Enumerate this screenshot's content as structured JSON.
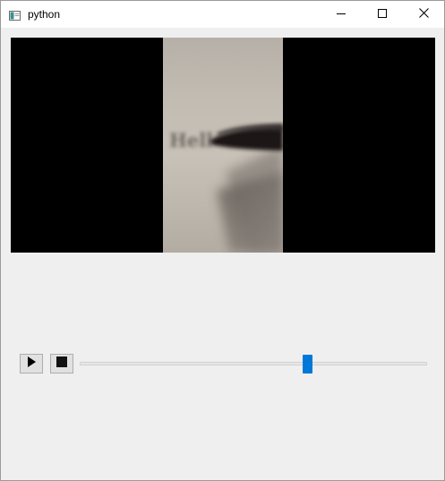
{
  "window": {
    "title": "python",
    "app_icon": "python-window-icon"
  },
  "title_controls": {
    "minimize_icon": "minimize-icon",
    "maximize_icon": "maximize-icon",
    "close_icon": "close-icon"
  },
  "video": {
    "frame_text": "Hell",
    "background_color": "#000000"
  },
  "controls": {
    "play_icon": "play-icon",
    "stop_icon": "stop-icon",
    "position_fraction": 0.66,
    "accent_color": "#0078d7"
  }
}
